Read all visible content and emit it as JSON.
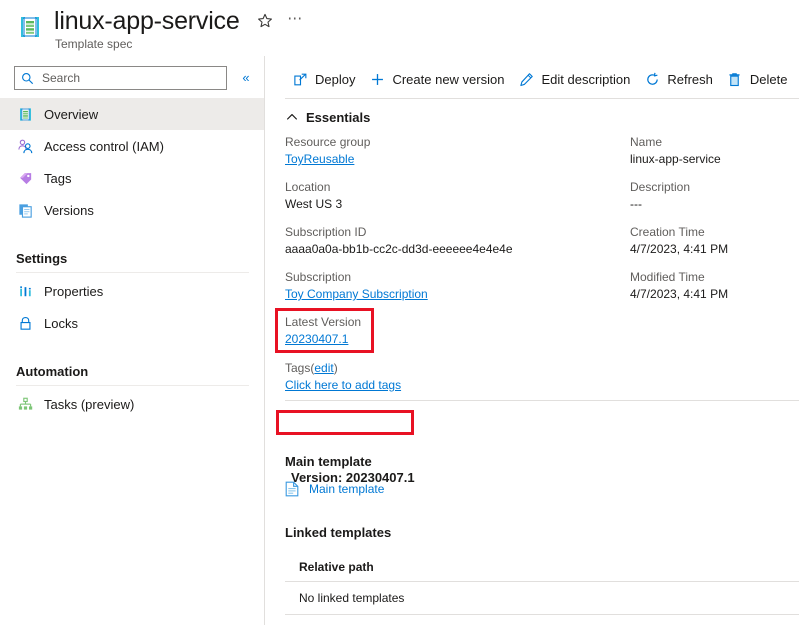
{
  "header": {
    "title": "linux-app-service",
    "subtitle": "Template spec",
    "resource_icon": "template-spec-icon",
    "favorite_icon": "star-icon",
    "more_icon": "ellipsis-icon"
  },
  "sidebar": {
    "search": {
      "placeholder": "Search",
      "value": "",
      "icon": "search-icon"
    },
    "collapse_icon": "chevron-double-left-icon",
    "items": [
      {
        "label": "Overview",
        "icon": "template-spec-icon",
        "selected": true
      },
      {
        "label": "Access control (IAM)",
        "icon": "people-icon",
        "selected": false
      },
      {
        "label": "Tags",
        "icon": "tag-icon",
        "selected": false
      },
      {
        "label": "Versions",
        "icon": "copy-pages-icon",
        "selected": false
      }
    ],
    "groups": [
      {
        "title": "Settings",
        "items": [
          {
            "label": "Properties",
            "icon": "bar-chart-icon"
          },
          {
            "label": "Locks",
            "icon": "lock-icon"
          }
        ]
      },
      {
        "title": "Automation",
        "items": [
          {
            "label": "Tasks (preview)",
            "icon": "hierarchy-icon"
          }
        ]
      }
    ]
  },
  "toolbar": {
    "buttons": [
      {
        "label": "Deploy",
        "icon": "open-in-new-icon"
      },
      {
        "label": "Create new version",
        "icon": "plus-icon"
      },
      {
        "label": "Edit description",
        "icon": "pencil-icon"
      },
      {
        "label": "Refresh",
        "icon": "refresh-icon"
      },
      {
        "label": "Delete",
        "icon": "trash-icon"
      }
    ]
  },
  "essentials": {
    "label": "Essentials",
    "chevron_icon": "chevron-up-icon",
    "left_fields": [
      {
        "key": "Resource group",
        "value": "ToyReusable",
        "is_link": true
      },
      {
        "key": "Location",
        "value": "West US 3",
        "is_link": false
      },
      {
        "key": "Subscription ID",
        "value": "aaaa0a0a-bb1b-cc2c-dd3d-eeeeee4e4e4e",
        "is_link": false
      },
      {
        "key": "Subscription",
        "value": "Toy Company Subscription",
        "is_link": true
      },
      {
        "key": "Latest Version",
        "value": "20230407.1",
        "is_link": true,
        "highlighted": true
      }
    ],
    "right_fields": [
      {
        "key": "Name",
        "value": "linux-app-service"
      },
      {
        "key": "Description",
        "value": "---"
      },
      {
        "key": "Creation Time",
        "value": "4/7/2023, 4:41 PM"
      },
      {
        "key": "Modified Time",
        "value": "4/7/2023, 4:41 PM"
      }
    ],
    "tags": {
      "label": "Tags",
      "edit_label": "edit",
      "open_paren": "(",
      "close_paren": ")",
      "add_link": "Click here to add tags"
    }
  },
  "version_section": {
    "version_line": "Version: 20230407.1",
    "highlighted": true,
    "main_template_heading": "Main template",
    "main_template_link": "Main template",
    "main_template_icon": "file-document-icon",
    "linked_templates_heading": "Linked templates",
    "table": {
      "columns": [
        "Relative path"
      ],
      "rows": [
        [
          "No linked templates"
        ]
      ]
    }
  },
  "colors": {
    "accent": "#0078d4",
    "highlight": "#e81123",
    "selected_bg": "#edebe9",
    "muted_text": "#605e5c",
    "divider": "#e1dfdd"
  }
}
